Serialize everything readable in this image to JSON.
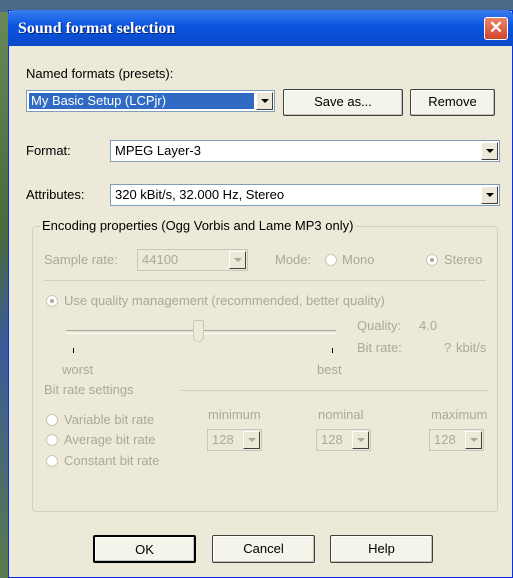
{
  "window": {
    "title": "Sound format selection",
    "close_label": "✕"
  },
  "presets": {
    "label": "Named formats (presets):",
    "selected": "My Basic Setup (LCPjr)",
    "save_as_label": "Save as...",
    "remove_label": "Remove"
  },
  "format": {
    "label": "Format:",
    "value": "MPEG Layer-3"
  },
  "attributes": {
    "label": "Attributes:",
    "value": "320 kBit/s, 32.000 Hz, Stereo"
  },
  "encoding": {
    "legend": "Encoding properties (Ogg Vorbis and Lame MP3 only)",
    "sample_rate_label": "Sample rate:",
    "sample_rate_value": "44100",
    "mode_label": "Mode:",
    "mode_mono": "Mono",
    "mode_stereo": "Stereo",
    "mode_selected": "Stereo",
    "quality_management_label": "Use quality management (recommended, better quality)",
    "quality_label": "Quality:",
    "quality_value": "4.0",
    "bitrate_label": "Bit rate:",
    "bitrate_value": "?",
    "bitrate_unit": "kbit/s",
    "slider_min_label": "worst",
    "slider_max_label": "best",
    "slider_level": 0.49
  },
  "bitrate_settings": {
    "legend": "Bit rate settings",
    "options": [
      "Variable bit rate",
      "Average bit rate",
      "Constant bit rate"
    ],
    "minimum_label": "minimum",
    "nominal_label": "nominal",
    "maximum_label": "maximum",
    "minimum_value": "128",
    "nominal_value": "128",
    "maximum_value": "128"
  },
  "buttons": {
    "ok": "OK",
    "cancel": "Cancel",
    "help": "Help"
  }
}
